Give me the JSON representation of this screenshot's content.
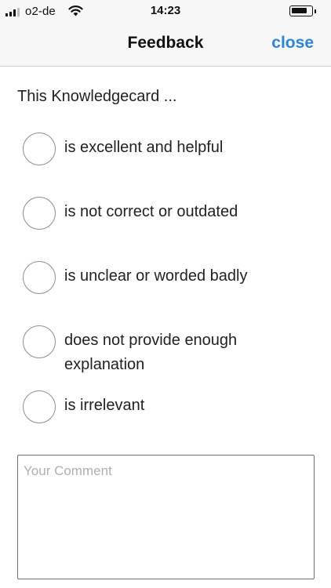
{
  "status_bar": {
    "carrier": "o2-de",
    "time": "14:23",
    "signal_bars_filled": 3,
    "battery_level": 0.7
  },
  "nav": {
    "title": "Feedback",
    "close_label": "close"
  },
  "form": {
    "intro": "This Knowledgecard ...",
    "options": [
      {
        "label": "is excellent and helpful",
        "selected": false
      },
      {
        "label": "is not correct or outdated",
        "selected": false
      },
      {
        "label": "is unclear or worded badly",
        "selected": false
      },
      {
        "label": "does not provide enough explanation",
        "selected": false
      },
      {
        "label": "is irrelevant",
        "selected": false
      }
    ],
    "comment": {
      "placeholder": "Your Comment",
      "value": ""
    }
  },
  "colors": {
    "accent": "#2f86d6",
    "bar_background": "#f7f7f7",
    "radio_border": "#8e8e8e"
  },
  "icons": {
    "signal": "signal-bars-icon",
    "wifi": "wifi-icon",
    "battery": "battery-icon"
  }
}
